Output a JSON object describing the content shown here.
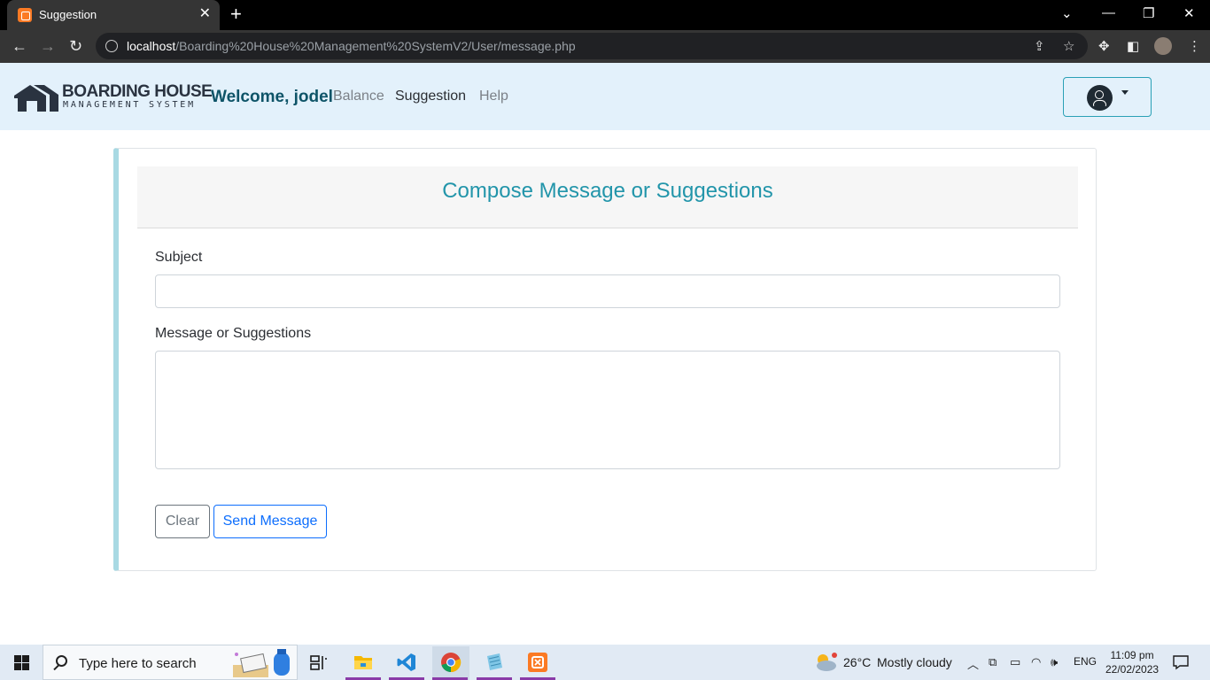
{
  "browser": {
    "tab_title": "Suggestion",
    "url_host": "localhost",
    "url_path": "/Boarding%20House%20Management%20SystemV2/User/message.php"
  },
  "navbar": {
    "brand_line1": "BOARDING HOUSE",
    "brand_line2": "MANAGEMENT SYSTEM",
    "welcome": "Welcome, jodel",
    "links": [
      "Balance",
      "Suggestion",
      "Help"
    ]
  },
  "form": {
    "title": "Compose Message or Suggestions",
    "subject_label": "Subject",
    "subject_value": "",
    "message_label": "Message or Suggestions",
    "message_value": "",
    "clear_label": "Clear",
    "send_label": "Send Message"
  },
  "taskbar": {
    "search_placeholder": "Type here to search",
    "weather_temp": "26°C",
    "weather_desc": "Mostly cloudy",
    "language": "ENG",
    "time": "11:09 pm",
    "date": "22/02/2023"
  },
  "colors": {
    "accent": "#2295aa",
    "navbar_bg": "#e3f1fb",
    "card_border_left": "#a8d9e3",
    "send_button": "#0d6efd"
  }
}
